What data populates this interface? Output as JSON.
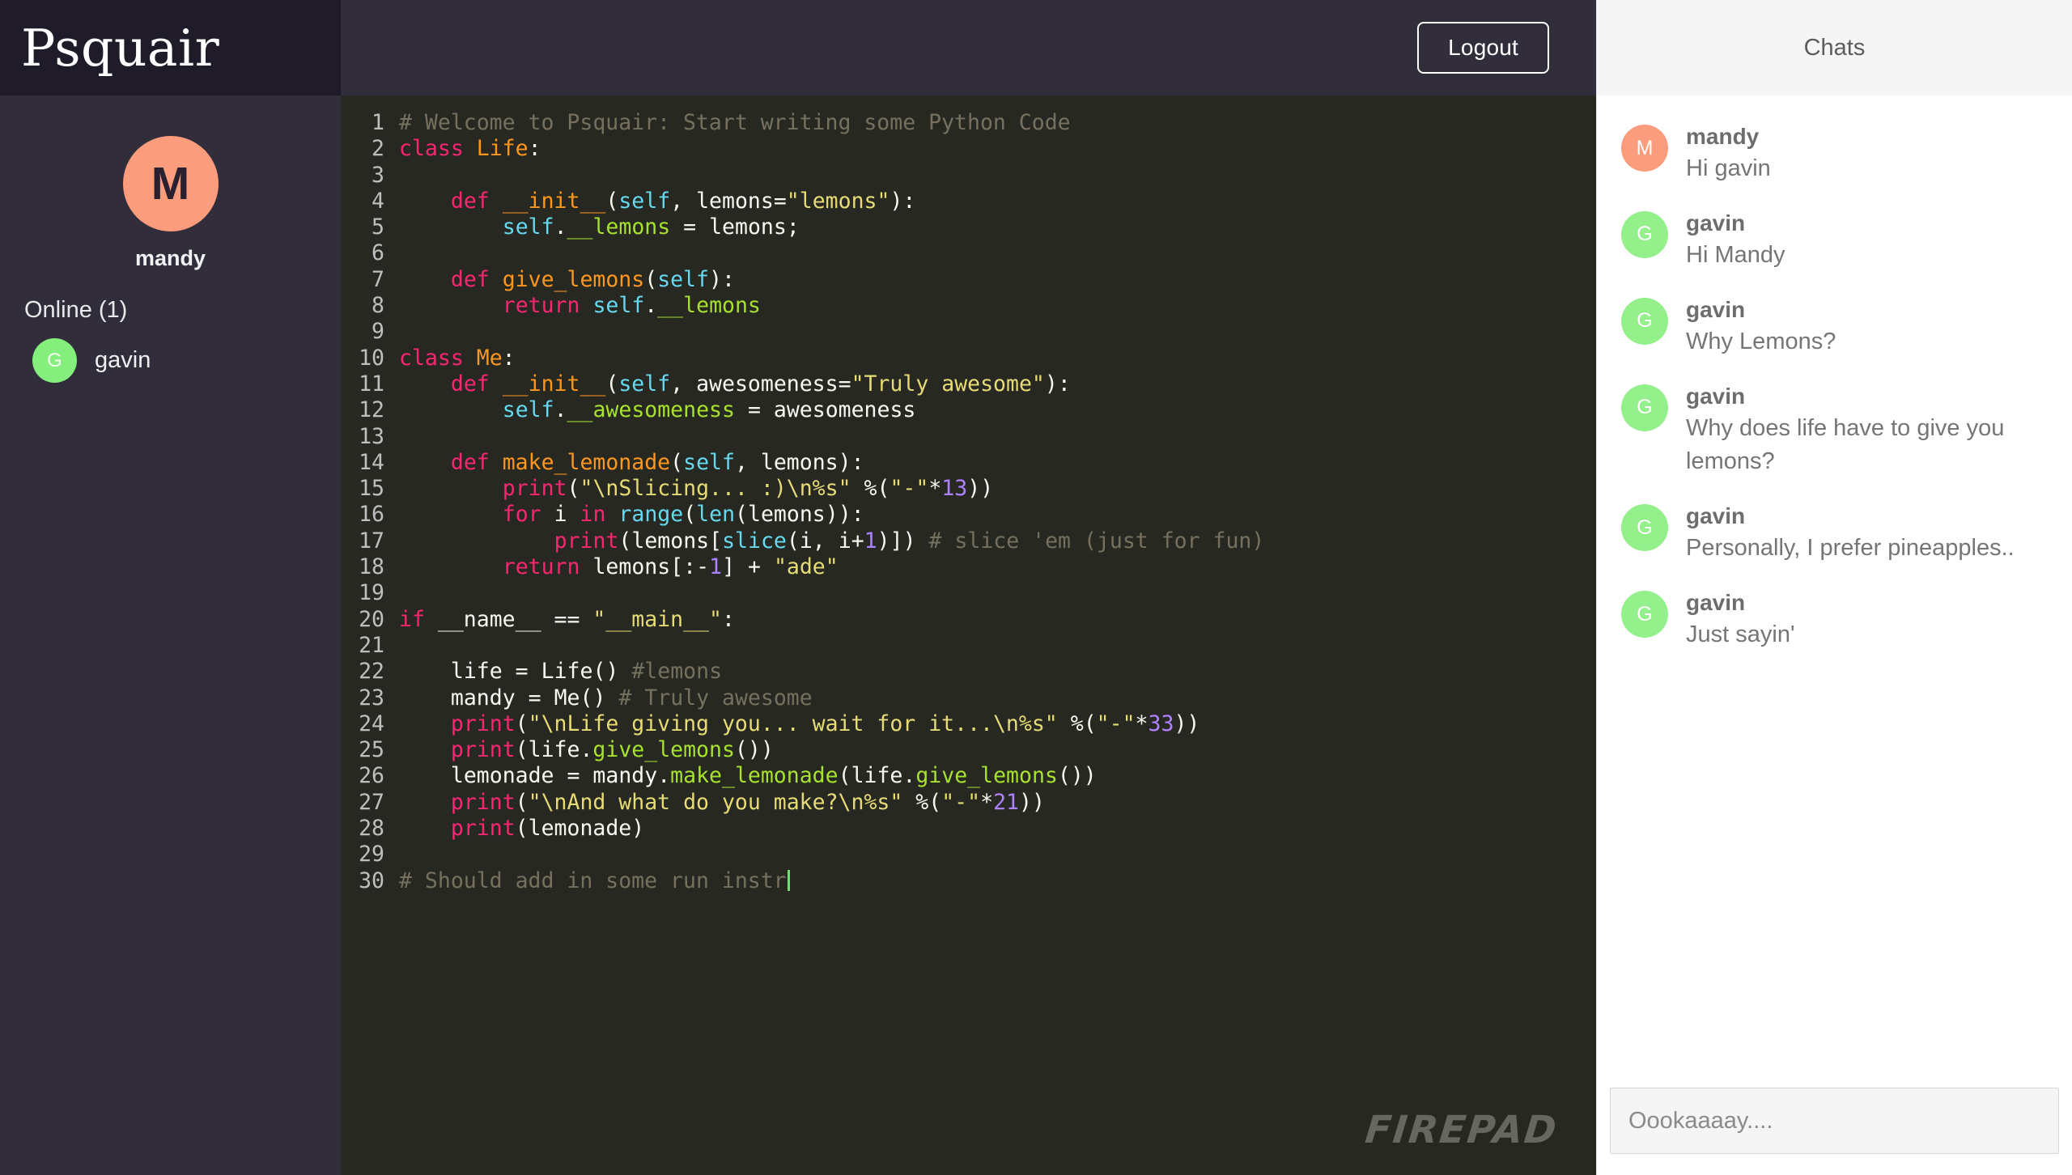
{
  "brand": {
    "title": "Psquair"
  },
  "topbar": {
    "logout_label": "Logout"
  },
  "sidebar": {
    "profile": {
      "initial": "M",
      "name": "mandy",
      "avatar_color": "#fb9c7c"
    },
    "online_label": "Online (1)",
    "online_users": [
      {
        "initial": "G",
        "name": "gavin",
        "avatar_color": "#84ef7c"
      }
    ]
  },
  "editor": {
    "watermark": "FIREPAD",
    "language": "Python",
    "lines": [
      {
        "n": "1",
        "text": "# Welcome to Psquair: Start writing some Python Code"
      },
      {
        "n": "2",
        "text": "class Life:"
      },
      {
        "n": "3",
        "text": ""
      },
      {
        "n": "4",
        "text": "    def __init__(self, lemons=\"lemons\"):"
      },
      {
        "n": "5",
        "text": "        self.__lemons = lemons;"
      },
      {
        "n": "6",
        "text": ""
      },
      {
        "n": "7",
        "text": "    def give_lemons(self):"
      },
      {
        "n": "8",
        "text": "        return self.__lemons"
      },
      {
        "n": "9",
        "text": ""
      },
      {
        "n": "10",
        "text": "class Me:"
      },
      {
        "n": "11",
        "text": "    def __init__(self, awesomeness=\"Truly awesome\"):"
      },
      {
        "n": "12",
        "text": "        self.__awesomeness = awesomeness"
      },
      {
        "n": "13",
        "text": ""
      },
      {
        "n": "14",
        "text": "    def make_lemonade(self, lemons):"
      },
      {
        "n": "15",
        "text": "        print(\"\\nSlicing... :)\\n%s\" %(\"-\"*13))"
      },
      {
        "n": "16",
        "text": "        for i in range(len(lemons)):"
      },
      {
        "n": "17",
        "text": "            print(lemons[slice(i, i+1)]) # slice 'em (just for fun)"
      },
      {
        "n": "18",
        "text": "        return lemons[:-1] + \"ade\""
      },
      {
        "n": "19",
        "text": ""
      },
      {
        "n": "20",
        "text": "if __name__ == \"__main__\":"
      },
      {
        "n": "21",
        "text": ""
      },
      {
        "n": "22",
        "text": "    life = Life() #lemons"
      },
      {
        "n": "23",
        "text": "    mandy = Me() # Truly awesome"
      },
      {
        "n": "24",
        "text": "    print(\"\\nLife giving you... wait for it...\\n%s\" %(\"-\"*33))"
      },
      {
        "n": "25",
        "text": "    print(life.give_lemons())"
      },
      {
        "n": "26",
        "text": "    lemonade = mandy.make_lemonade(life.give_lemons())"
      },
      {
        "n": "27",
        "text": "    print(\"\\nAnd what do you make?\\n%s\" %(\"-\"*21))"
      },
      {
        "n": "28",
        "text": "    print(lemonade)"
      },
      {
        "n": "29",
        "text": ""
      },
      {
        "n": "30",
        "text": "# Should add in some run instr"
      }
    ]
  },
  "chat": {
    "header_title": "Chats",
    "messages": [
      {
        "initial": "M",
        "user": "mandy",
        "text": "Hi gavin",
        "avatar_color": "#fb9c7c"
      },
      {
        "initial": "G",
        "user": "gavin",
        "text": "Hi Mandy",
        "avatar_color": "#93f08a"
      },
      {
        "initial": "G",
        "user": "gavin",
        "text": "Why Lemons?",
        "avatar_color": "#93f08a"
      },
      {
        "initial": "G",
        "user": "gavin",
        "text": "Why does life have to give you lemons?",
        "avatar_color": "#93f08a"
      },
      {
        "initial": "G",
        "user": "gavin",
        "text": "Personally, I prefer pineapples..",
        "avatar_color": "#93f08a"
      },
      {
        "initial": "G",
        "user": "gavin",
        "text": "Just sayin'",
        "avatar_color": "#93f08a"
      }
    ],
    "input": {
      "value": "",
      "placeholder": "Oookaaaay...."
    }
  },
  "colors": {
    "sidebar_bg": "#322d3b",
    "brand_bg": "#201b29",
    "editor_bg": "#272822",
    "accent_peach": "#fb9c7c",
    "accent_green": "#84ef7c"
  }
}
